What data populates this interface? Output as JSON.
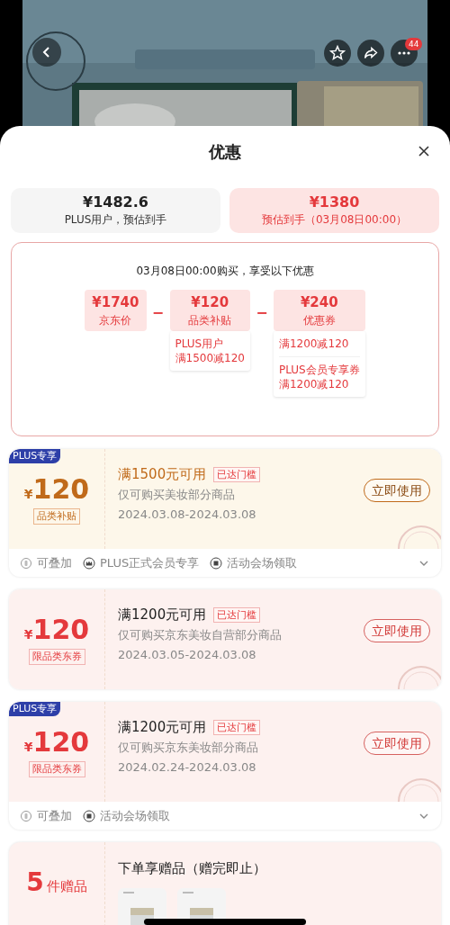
{
  "banner": {
    "kind": "picture",
    "more_badge": "44"
  },
  "sheet": {
    "title": "优惠"
  },
  "price_options": [
    {
      "price": "¥1482.6",
      "label": "PLUS用户，预估到手",
      "selected": false
    },
    {
      "price": "¥1380",
      "label": "预估到手（03月08日00:00）",
      "selected": true
    }
  ],
  "breakdown": {
    "heading": "03月08日00:00购买，享受以下优惠",
    "items": [
      {
        "amount": "¥1740",
        "label": "京东价"
      },
      {
        "operator": "−",
        "amount": "¥120",
        "label": "品类补贴",
        "details": [
          {
            "lines": [
              "PLUS用户",
              "满1500减120"
            ]
          }
        ]
      },
      {
        "operator": "−",
        "amount": "¥240",
        "label": "优惠券",
        "details": [
          {
            "lines": [
              "满1200减120"
            ]
          },
          {
            "lines": [
              "PLUS会员专享券",
              "满1200减120"
            ]
          }
        ]
      }
    ]
  },
  "coupons": [
    {
      "kind": "subsidy",
      "plus_badge": "PLUS专享",
      "currency": "¥",
      "amount": "120",
      "type_label": "品类补贴",
      "condition": "满1500元可用",
      "threshold_tag": "已达门槛",
      "scope": "仅可购买美妆部分商品",
      "validity": "2024.03.08-2024.03.08",
      "button": "立即使用",
      "claimed": true,
      "footer": [
        {
          "kind": "stackable",
          "text": "可叠加"
        },
        {
          "kind": "plus",
          "text": "PLUS正式会员专享"
        },
        {
          "kind": "venue",
          "text": "活动会场领取"
        }
      ],
      "expanded": false
    },
    {
      "kind": "coupon",
      "currency": "¥",
      "amount": "120",
      "type_label": "限品类东券",
      "condition": "满1200元可用",
      "threshold_tag": "已达门槛",
      "scope": "仅可购买京东美妆自营部分商品",
      "validity": "2024.03.05-2024.03.08",
      "button": "立即使用",
      "claimed": true
    },
    {
      "kind": "coupon",
      "plus_badge": "PLUS专享",
      "currency": "¥",
      "amount": "120",
      "type_label": "限品类东券",
      "condition": "满1200元可用",
      "threshold_tag": "已达门槛",
      "scope": "仅可购买京东美妆部分商品",
      "validity": "2024.02.24-2024.03.08",
      "button": "立即使用",
      "claimed": true,
      "footer": [
        {
          "kind": "stackable",
          "text": "可叠加"
        },
        {
          "kind": "venue",
          "text": "活动会场领取"
        }
      ],
      "expanded": false
    }
  ],
  "gift": {
    "count": "5",
    "unit": "件赠品",
    "title": "下单享赠品（赠完即止）"
  }
}
